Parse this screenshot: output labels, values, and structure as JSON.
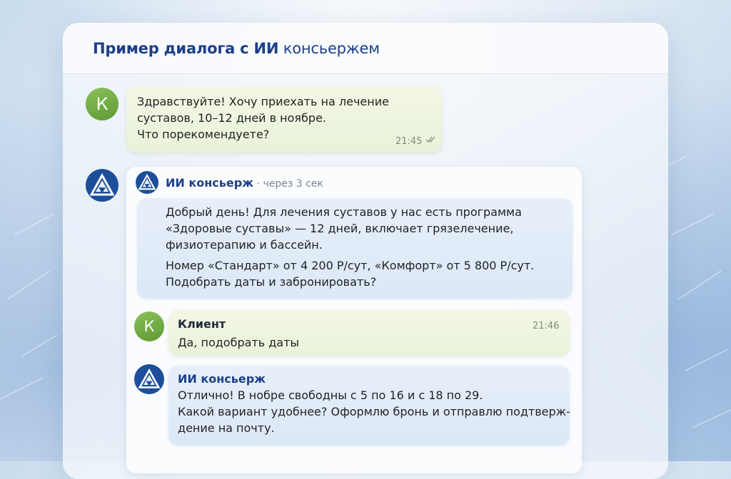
{
  "colors": {
    "accent": "#1d3f8a",
    "client_bubble": "#eef5e0",
    "ai_bubble": "#e2ecf8",
    "client_avatar": "#6fa843",
    "ai_avatar": "#1d4e9a"
  },
  "header": {
    "title_bold": "Пример диалога с ИИ",
    "title_rest": " консьержем"
  },
  "messages": {
    "m1": {
      "avatar_letter": "К",
      "lines": [
        "Здравствуйте! Хочу приехать на лечение",
        "суставов, 10–12 дней в ноябре.",
        "Что порекомендуете?"
      ],
      "time": "21:45",
      "status_icon": "double-check-icon"
    },
    "m2": {
      "avatar_icon": "triangle-logo-icon",
      "sender": "ИИ консьерж",
      "meta": " · через 3 сек",
      "paragraph1": [
        "Добрый день! Для лечения суставов у нас есть программа",
        "«Здоровые суставы» — 12 дней, включает грязелечение,",
        "физиотерапию и бассейн."
      ],
      "paragraph2": [
        "Номер «Стандарт» от 4 200 Р/сут, «Комфорт» от 5 800 Р/сут.",
        "Подобрать даты и забронировать?"
      ]
    },
    "m3": {
      "avatar_letter": "К",
      "sender": "Клиент",
      "time": "21:46",
      "text": "Да, подобрать даты"
    },
    "m4": {
      "avatar_icon": "triangle-logo-icon",
      "sender": "ИИ консьерж",
      "lines": [
        "Отлично! В нобре свободны с 5 по 16 и с 18 по 29.",
        "Какой вариант удобнее? Оформлю бронь и отправлю подтверж-",
        "дение на почту."
      ]
    }
  }
}
